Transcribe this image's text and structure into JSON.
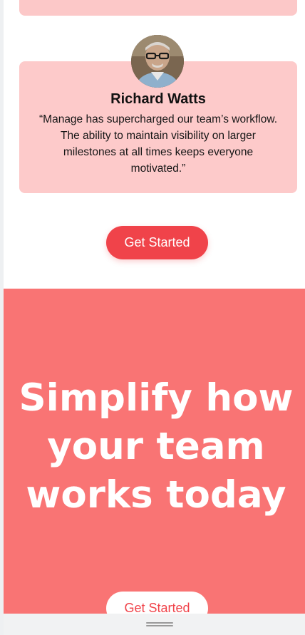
{
  "testimonial": {
    "author": "Richard Watts",
    "quote": "“Manage has supercharged our team’s workflow. The ability to maintain visibility on larger milestones at all times keeps everyone motivated.”",
    "avatar_icon": "person-avatar-icon"
  },
  "cta_primary": {
    "label": "Get Started"
  },
  "hero": {
    "title": "Simplify how your team works today",
    "cta_label": "Get Started"
  },
  "colors": {
    "accent": "#f0434a",
    "card_bg": "#fdcaca",
    "hero_bg": "#f97474"
  }
}
